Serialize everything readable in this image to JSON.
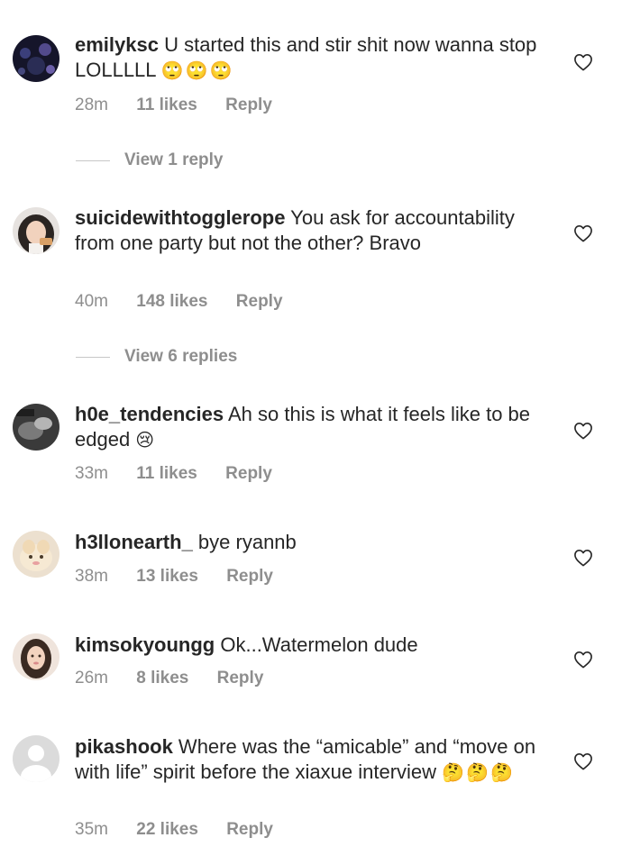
{
  "comments": [
    {
      "username": "emilyksc",
      "text": " U started this and stir shit now wanna stop LOLLLLL ",
      "emoji": "🙄🙄🙄",
      "time": "28m",
      "likes": "11 likes",
      "reply": "Reply"
    },
    {
      "username": "suicidewithtogglerope",
      "text": " You ask for accountability from one party but not the other? Bravo",
      "emoji": "",
      "time": "40m",
      "likes": "148 likes",
      "reply": "Reply"
    },
    {
      "username": "h0e_tendencies",
      "text": " Ah so this is what it feels like to be edged ",
      "emoji": "😢",
      "time": "33m",
      "likes": "11 likes",
      "reply": "Reply"
    },
    {
      "username": "h3llonearth_",
      "text": " bye ryannb",
      "emoji": "",
      "time": "38m",
      "likes": "13 likes",
      "reply": "Reply"
    },
    {
      "username": "kimsokyoungg",
      "text": " Ok...Watermelon dude",
      "emoji": "",
      "time": "26m",
      "likes": "8 likes",
      "reply": "Reply"
    },
    {
      "username": "pikashook",
      "text": " Where was the “amicable” and “move on with life” spirit before the xiaxue interview ",
      "emoji": "🤔🤔🤔",
      "time": "35m",
      "likes": "22 likes",
      "reply": "Reply"
    }
  ],
  "view_replies": [
    {
      "label": "View 1 reply"
    },
    {
      "label": "View 6 replies"
    }
  ]
}
